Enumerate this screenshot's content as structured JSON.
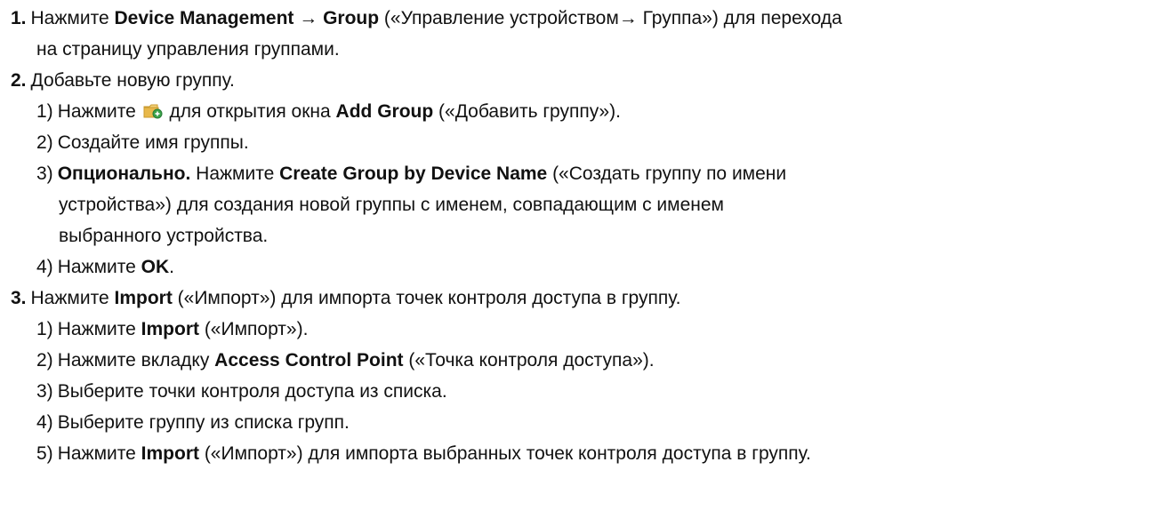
{
  "steps": [
    {
      "number": "1.",
      "line1": {
        "pre": "Нажмите ",
        "bold": "Device Management → Group",
        "post": " («Управление устройством→ Группа») для перехода"
      },
      "line2": "на страницу управления группами."
    },
    {
      "number": "2.",
      "text": "Добавьте новую группу.",
      "substeps": [
        {
          "number": "1)",
          "pre": "Нажмите ",
          "icon": "add-folder-icon",
          "mid": " для открытия окна ",
          "bold": "Add Group",
          "post": " («Добавить группу»)."
        },
        {
          "number": "2)",
          "text": "Создайте имя группы."
        },
        {
          "number": "3)",
          "bold1": "Опционально.",
          "mid": " Нажмите ",
          "bold2": "Create Group by Device Name",
          "post": " («Создать группу по имени",
          "line2": "устройства») для создания новой группы с именем, совпадающим с именем",
          "line3": "выбранного устройства."
        },
        {
          "number": "4)",
          "pre": "Нажмите ",
          "bold": "OK",
          "post": "."
        }
      ]
    },
    {
      "number": "3.",
      "pre": "Нажмите ",
      "bold": "Import",
      "post": " («Импорт») для импорта точек контроля доступа в группу.",
      "substeps": [
        {
          "number": "1)",
          "pre": "Нажмите ",
          "bold": "Import",
          "post": " («Импорт»)."
        },
        {
          "number": "2)",
          "pre": "Нажмите вкладку ",
          "bold": "Access Control Point",
          "post": " («Точка контроля доступа»)."
        },
        {
          "number": "3)",
          "text": "Выберите точки контроля доступа из списка."
        },
        {
          "number": "4)",
          "text": "Выберите группу из списка групп."
        },
        {
          "number": "5)",
          "pre": "Нажмите ",
          "bold": "Import",
          "post": " («Импорт») для импорта выбранных точек контроля доступа в группу."
        }
      ]
    }
  ],
  "colors": {
    "text": "#111111",
    "icon_folder": "#e8b84a",
    "icon_plus": "#3aa34a"
  }
}
